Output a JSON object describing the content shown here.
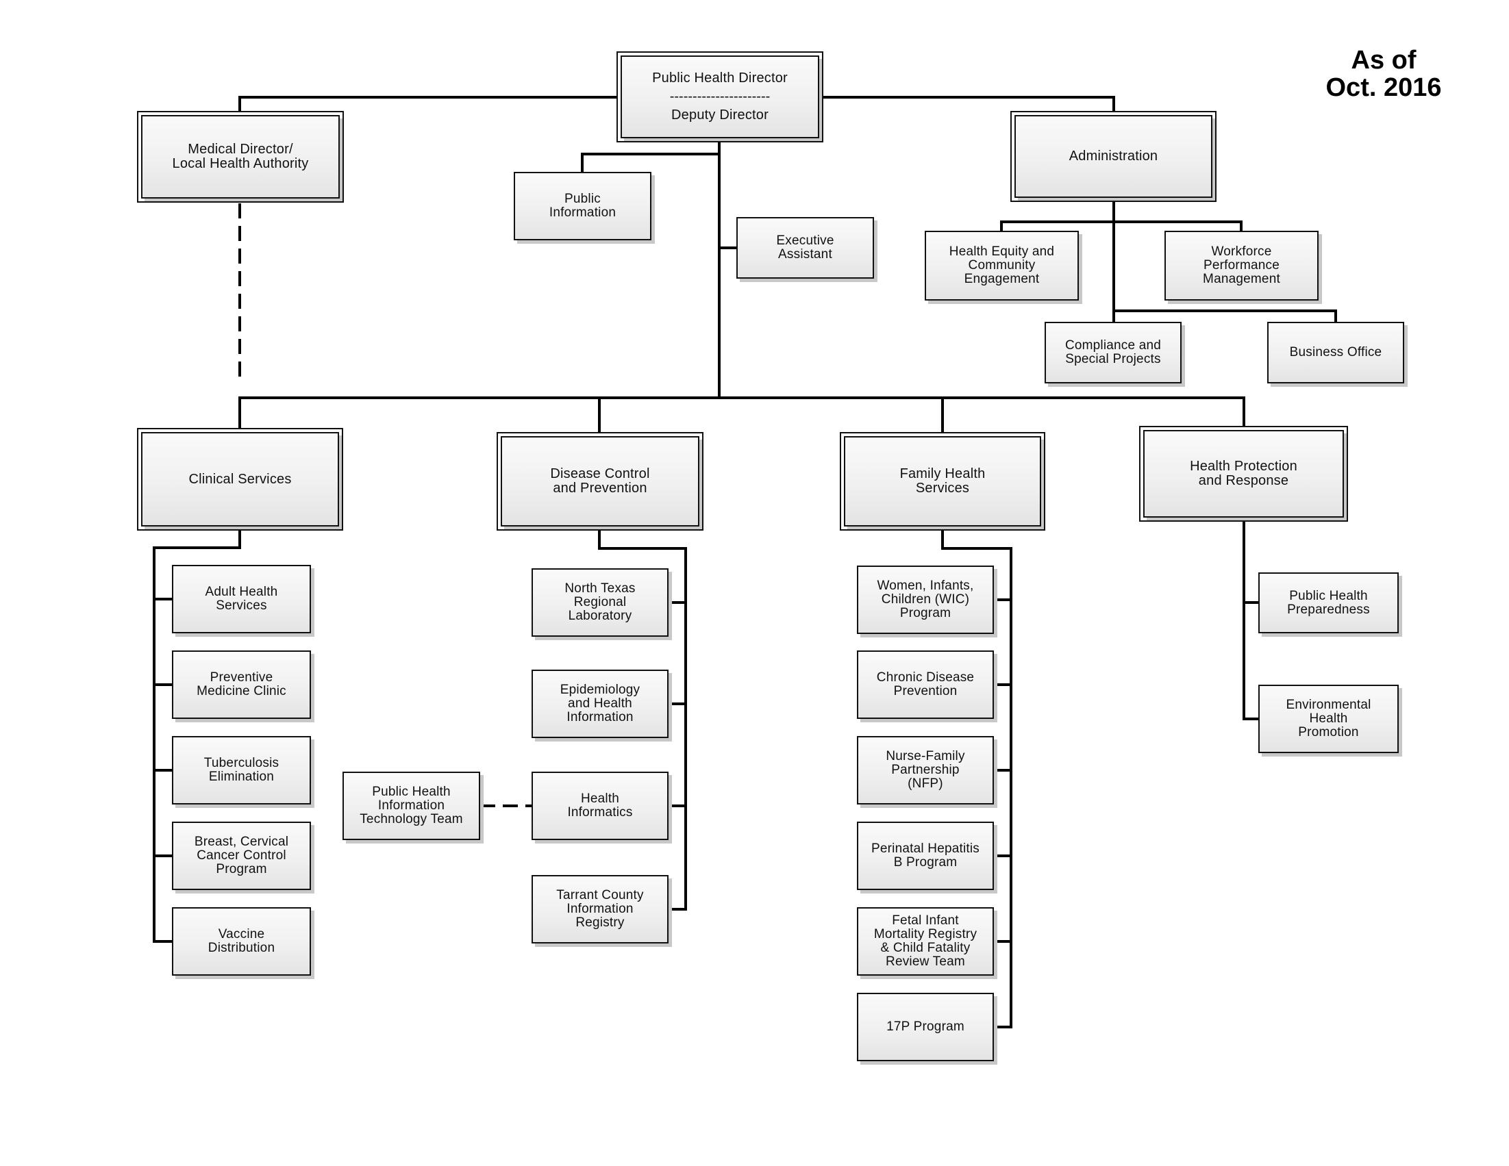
{
  "stamp": "As of\nOct. 2016",
  "director": {
    "title": "Public Health Director",
    "separator": "----------------------",
    "deputy": "Deputy Director"
  },
  "top_units": {
    "medical": "Medical Director/\nLocal Health Authority",
    "public_information": "Public\nInformation",
    "executive_assistant": "Executive\nAssistant",
    "administration": "Administration"
  },
  "administration_units": [
    "Health Equity and\nCommunity\nEngagement",
    "Workforce\nPerformance\nManagement",
    "Compliance and\nSpecial Projects",
    "Business Office"
  ],
  "divisions": [
    {
      "name": "Clinical Services",
      "units": [
        "Adult Health\nServices",
        "Preventive\nMedicine Clinic",
        "Tuberculosis\nElimination",
        "Breast, Cervical\nCancer Control\nProgram",
        "Vaccine\nDistribution"
      ]
    },
    {
      "name": "Disease Control\nand Prevention",
      "units": [
        "North Texas\nRegional\nLaboratory",
        "Epidemiology\nand Health\nInformation",
        "Health\nInformatics",
        "Tarrant County\nInformation\nRegistry"
      ],
      "dotted_partner": "Public Health\nInformation\nTechnology Team"
    },
    {
      "name": "Family Health\nServices",
      "units": [
        "Women, Infants,\nChildren (WIC)\nProgram",
        "Chronic Disease\nPrevention",
        "Nurse-Family\nPartnership\n(NFP)",
        "Perinatal Hepatitis\nB Program",
        "Fetal Infant\nMortality Registry\n& Child Fatality\nReview Team",
        "17P Program"
      ]
    },
    {
      "name": "Health Protection\nand Response",
      "units": [
        "Public Health\nPreparedness",
        "Environmental\nHealth\nPromotion"
      ]
    }
  ]
}
